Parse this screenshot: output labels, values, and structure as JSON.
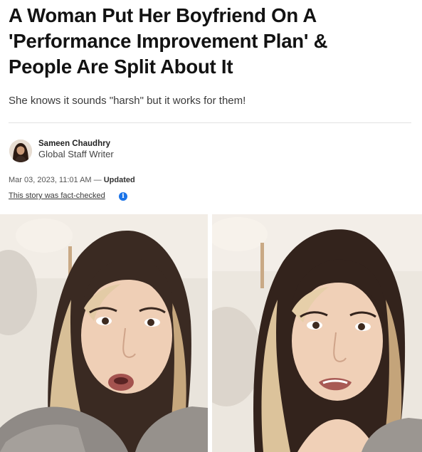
{
  "article": {
    "headline_lines": [
      "A Woman Put Her Boyfriend On A",
      "'Performance Improvement Plan' &",
      "People Are Split About It"
    ],
    "dek": "She knows it sounds \"harsh\" but it works for them!",
    "author": {
      "name": "Sameen Chaudhry",
      "role": "Global Staff Writer"
    },
    "date": "Mar 03, 2023, 11:01 AM",
    "updated_label": "Updated",
    "fact_check_label": "This story was fact-checked",
    "info_icon": "i"
  },
  "media": {
    "left_image": "woman-talking-to-camera-1",
    "right_image": "woman-talking-to-camera-2"
  }
}
